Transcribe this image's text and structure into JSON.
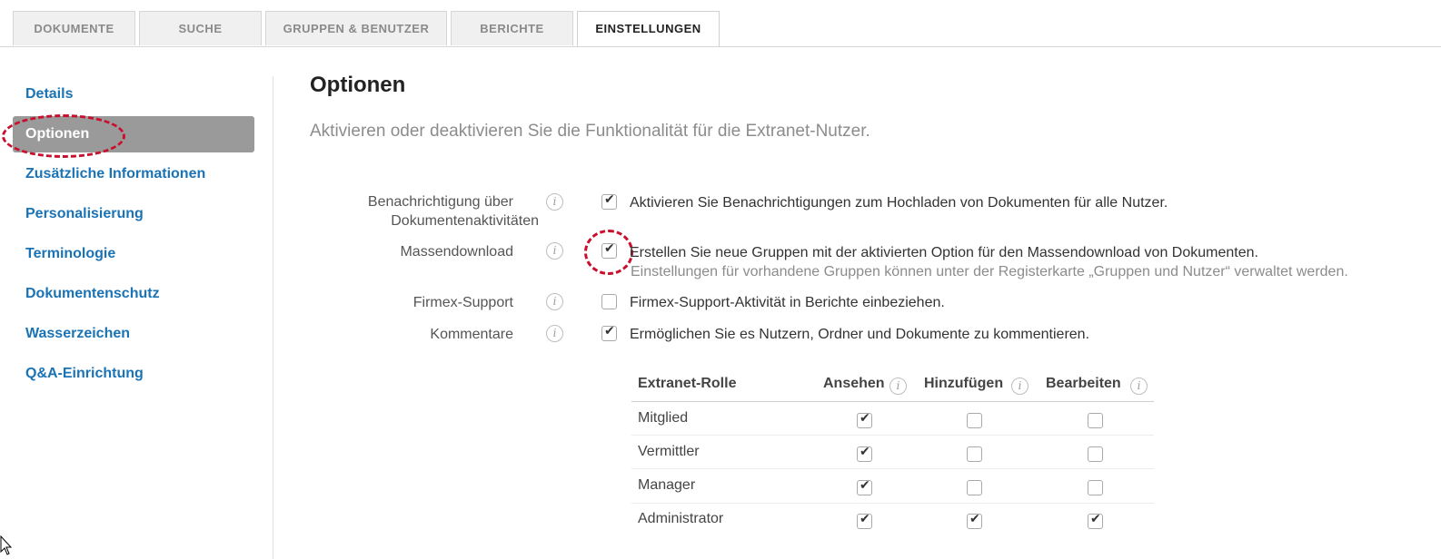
{
  "tabs": [
    {
      "label": "DOKUMENTE"
    },
    {
      "label": "SUCHE"
    },
    {
      "label": "GRUPPEN & BENUTZER"
    },
    {
      "label": "BERICHTE"
    },
    {
      "label": "EINSTELLUNGEN",
      "active": true
    }
  ],
  "sidebar": {
    "items": [
      {
        "label": "Details"
      },
      {
        "label": "Optionen",
        "active": true
      },
      {
        "label": "Zusätzliche Informationen"
      },
      {
        "label": "Personalisierung"
      },
      {
        "label": "Terminologie"
      },
      {
        "label": "Dokumentenschutz"
      },
      {
        "label": "Wasserzeichen"
      },
      {
        "label": "Q&A-Einrichtung"
      }
    ]
  },
  "main": {
    "title": "Optionen",
    "description": "Aktivieren oder deaktivieren Sie die Funktionalität für die Extranet-Nutzer.",
    "info_glyph": "i",
    "check_glyph": "✔",
    "options": [
      {
        "label_line1": "Benachrichtigung über",
        "label_line2": "Dokumentenaktivitäten",
        "checked": true,
        "text": "Aktivieren Sie Benachrichtigungen zum Hochladen von Dokumenten für alle Nutzer."
      },
      {
        "label_line1": "Massendownload",
        "checked": true,
        "text": "Erstellen Sie neue Gruppen mit der aktivierten Option für den Massendownload von Dokumenten.",
        "subtext": "Einstellungen für vorhandene Gruppen können unter der Registerkarte „Gruppen und Nutzer“ verwaltet werden."
      },
      {
        "label_line1": "Firmex-Support",
        "checked": false,
        "text": "Firmex-Support-Aktivität in Berichte einbeziehen."
      },
      {
        "label_line1": "Kommentare",
        "checked": true,
        "text": "Ermöglichen Sie es Nutzern, Ordner und Dokumente zu kommentieren."
      }
    ],
    "permissions": {
      "headers": {
        "role": "Extranet-Rolle",
        "view": "Ansehen",
        "add": "Hinzufügen",
        "edit": "Bearbeiten"
      },
      "rows": [
        {
          "role": "Mitglied",
          "view": true,
          "add": false,
          "edit": false
        },
        {
          "role": "Vermittler",
          "view": true,
          "add": false,
          "edit": false
        },
        {
          "role": "Manager",
          "view": true,
          "add": false,
          "edit": false
        },
        {
          "role": "Administrator",
          "view": true,
          "add": true,
          "edit": true
        }
      ]
    }
  },
  "colors": {
    "link": "#1a73b5",
    "active_item_bg": "#9a9a9a",
    "annotation": "#c8102e"
  }
}
